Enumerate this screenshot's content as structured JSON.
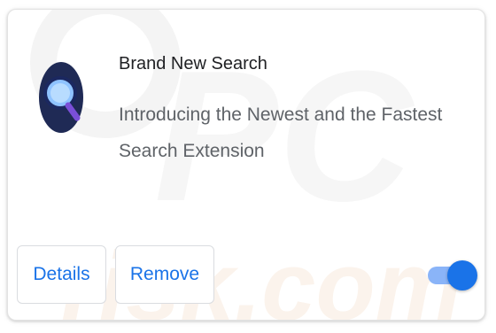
{
  "extension": {
    "name": "Brand New Search",
    "description": "Introducing the Newest and the Fastest Search Extension",
    "icon": "magnifier-icon",
    "enabled": true
  },
  "buttons": {
    "details_label": "Details",
    "remove_label": "Remove"
  },
  "colors": {
    "accent": "#1a73e8",
    "toggle_track": "#8ab4f8",
    "icon_ring": "#1f2a55",
    "icon_lens": "#8fc3ff"
  }
}
